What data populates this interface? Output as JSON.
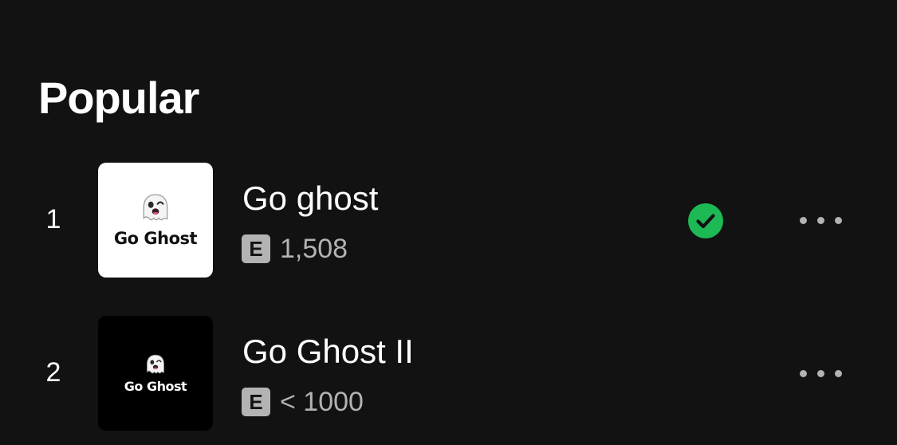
{
  "section": {
    "title": "Popular"
  },
  "tracks": [
    {
      "number": "1",
      "title": "Go ghost",
      "explicit_label": "E",
      "plays": "1,508",
      "cover_text": "Go Ghost",
      "cover_emoji_icon": "ghost-icon",
      "cover_style": "light",
      "saved": true,
      "saved_icon": "check-circle-icon",
      "more_icon": "more-options-icon"
    },
    {
      "number": "2",
      "title": "Go Ghost II",
      "explicit_label": "E",
      "plays": "< 1000",
      "cover_text": "Go Ghost",
      "cover_emoji_icon": "ghost-icon",
      "cover_style": "dark",
      "saved": false,
      "more_icon": "more-options-icon"
    }
  ],
  "colors": {
    "background": "#121212",
    "text_primary": "#ffffff",
    "text_secondary": "#b3b3b3",
    "accent_green": "#1ed760"
  }
}
